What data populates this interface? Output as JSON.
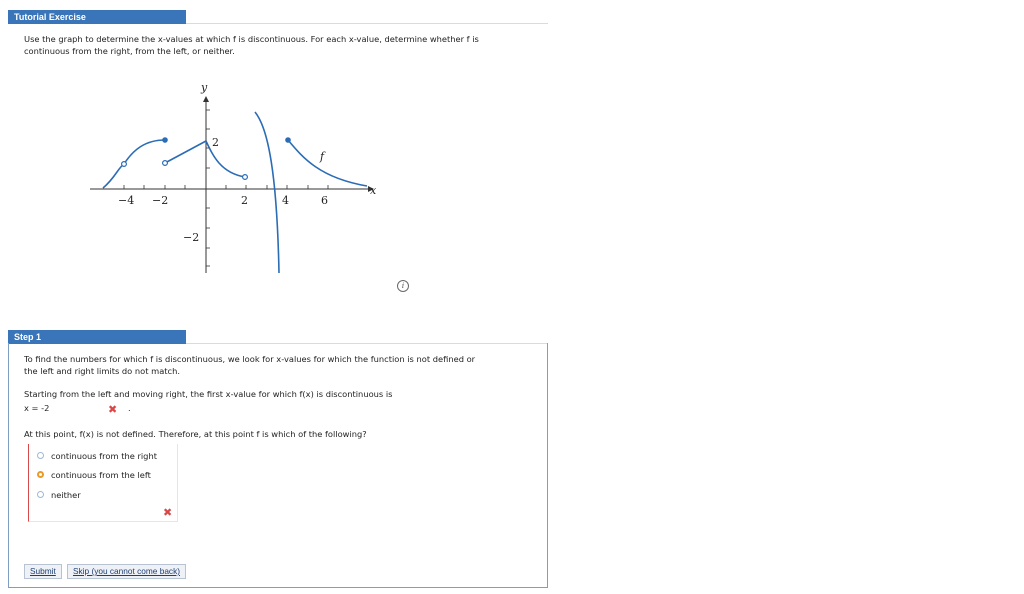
{
  "tutorial": {
    "header": "Tutorial Exercise",
    "prompt_line1": "Use the graph to determine the x-values at which f is discontinuous. For each x-value, determine whether f is",
    "prompt_line2": "continuous from the right, from the left, or neither."
  },
  "graph": {
    "y_axis_label": "y",
    "x_axis_label": "x",
    "function_label": "f",
    "x_tick_labels": [
      "−4",
      "−2",
      "2",
      "4",
      "6"
    ],
    "y_tick_labels": [
      "2",
      "−2"
    ],
    "curve_color": "#2a6cb5",
    "axis_color": "#333333"
  },
  "info_icon": "i",
  "step": {
    "header": "Step 1",
    "intro_line1": "To find the numbers for which f is discontinuous, we look for x-values for which the function is not defined or",
    "intro_line2": "the left and right limits do not match.",
    "question_line": "Starting from the left and moving right, the first x-value for which f(x) is discontinuous is",
    "answer_value": "x = -2",
    "answer_suffix": ".",
    "followup": "At this point, f(x) is not defined. Therefore, at this point f is which of the following?",
    "choices": [
      {
        "label": "continuous from the right",
        "selected": false
      },
      {
        "label": "continuous from the left",
        "selected": true
      },
      {
        "label": "neither",
        "selected": false
      }
    ],
    "wrong_mark": "✖"
  },
  "buttons": {
    "submit": "Submit",
    "skip": "Skip (you cannot come back)"
  },
  "colors": {
    "header_bg": "#3a75b9",
    "error": "#d94848",
    "selected_radio": "#e89a2c"
  }
}
